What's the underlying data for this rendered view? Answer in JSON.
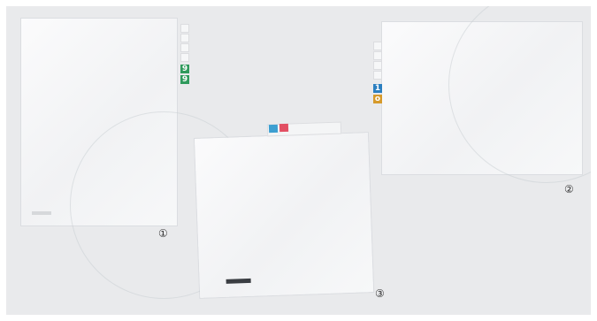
{
  "items": [
    {
      "label": "①",
      "tabs": [
        "9",
        "9"
      ],
      "tab_colors": [
        "#2f9a5c",
        "#2f9a5c"
      ]
    },
    {
      "label": "②",
      "tabs": [
        "1",
        "o"
      ],
      "tab_colors": [
        "#2b7fc0",
        "#d69a2b"
      ]
    },
    {
      "label": "③",
      "tabs": [
        "",
        ""
      ],
      "tab_colors": [
        "#3d9fd1",
        "#e24f63"
      ]
    }
  ],
  "colors": {
    "background": "#e9eaec",
    "folder": "#f4f5f6"
  }
}
